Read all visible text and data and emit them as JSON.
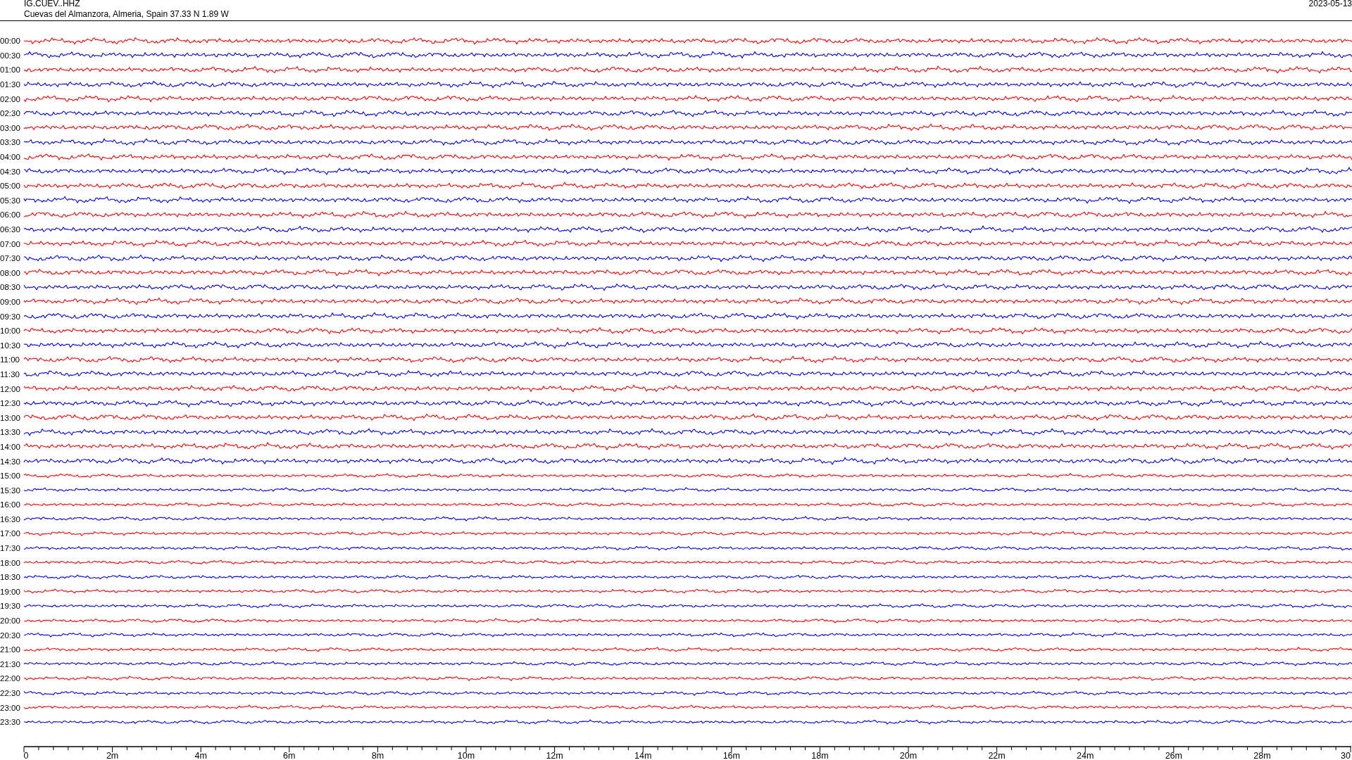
{
  "header": {
    "station": "IG.CUEV..HHZ",
    "location": "Cuevas del Almanzora, Almeria, Spain  37.33 N 1.89 W",
    "date": "2023-05-13"
  },
  "rows": [
    {
      "time": "00:00",
      "color": "#ff0000"
    },
    {
      "time": "00:30",
      "color": "#0000ff"
    },
    {
      "time": "01:00",
      "color": "#ff0000"
    },
    {
      "time": "01:30",
      "color": "#0000ff"
    },
    {
      "time": "02:00",
      "color": "#ff0000"
    },
    {
      "time": "02:30",
      "color": "#0000ff"
    },
    {
      "time": "03:00",
      "color": "#ff0000"
    },
    {
      "time": "03:30",
      "color": "#0000ff"
    },
    {
      "time": "04:00",
      "color": "#ff0000"
    },
    {
      "time": "04:30",
      "color": "#0000ff"
    },
    {
      "time": "05:00",
      "color": "#ff0000"
    },
    {
      "time": "05:30",
      "color": "#0000ff"
    },
    {
      "time": "06:00",
      "color": "#ff0000"
    },
    {
      "time": "06:30",
      "color": "#0000ff"
    },
    {
      "time": "07:00",
      "color": "#ff0000"
    },
    {
      "time": "07:30",
      "color": "#0000ff"
    },
    {
      "time": "08:00",
      "color": "#ff0000"
    },
    {
      "time": "08:30",
      "color": "#0000ff"
    },
    {
      "time": "09:00",
      "color": "#ff0000"
    },
    {
      "time": "09:30",
      "color": "#0000ff"
    },
    {
      "time": "10:00",
      "color": "#ff0000"
    },
    {
      "time": "10:30",
      "color": "#0000ff"
    },
    {
      "time": "11:00",
      "color": "#ff0000"
    },
    {
      "time": "11:30",
      "color": "#0000ff"
    },
    {
      "time": "12:00",
      "color": "#ff0000"
    },
    {
      "time": "12:30",
      "color": "#0000ff"
    },
    {
      "time": "13:00",
      "color": "#ff0000"
    },
    {
      "time": "13:30",
      "color": "#0000ff"
    },
    {
      "time": "14:00",
      "color": "#ff0000"
    },
    {
      "time": "14:30",
      "color": "#0000ff"
    },
    {
      "time": "15:00",
      "color": "#ff0000"
    },
    {
      "time": "15:30",
      "color": "#0000ff"
    },
    {
      "time": "16:00",
      "color": "#ff0000"
    },
    {
      "time": "16:30",
      "color": "#0000ff"
    },
    {
      "time": "17:00",
      "color": "#ff0000"
    },
    {
      "time": "17:30",
      "color": "#0000ff"
    },
    {
      "time": "18:00",
      "color": "#ff0000"
    },
    {
      "time": "18:30",
      "color": "#0000ff"
    },
    {
      "time": "19:00",
      "color": "#ff0000"
    },
    {
      "time": "19:30",
      "color": "#0000ff"
    },
    {
      "time": "20:00",
      "color": "#ff0000"
    },
    {
      "time": "20:30",
      "color": "#0000ff"
    },
    {
      "time": "21:00",
      "color": "#ff0000"
    },
    {
      "time": "21:30",
      "color": "#0000ff"
    },
    {
      "time": "22:00",
      "color": "#ff0000"
    },
    {
      "time": "22:30",
      "color": "#0000ff"
    },
    {
      "time": "23:00",
      "color": "#ff0000"
    },
    {
      "time": "23:30",
      "color": "#0000ff"
    }
  ],
  "x_axis": {
    "ticks": [
      "0",
      "2m",
      "4m",
      "6m",
      "8m",
      "10m",
      "12m",
      "14m",
      "16m",
      "18m",
      "20m",
      "22m",
      "24m",
      "26m",
      "28m",
      "30"
    ]
  }
}
